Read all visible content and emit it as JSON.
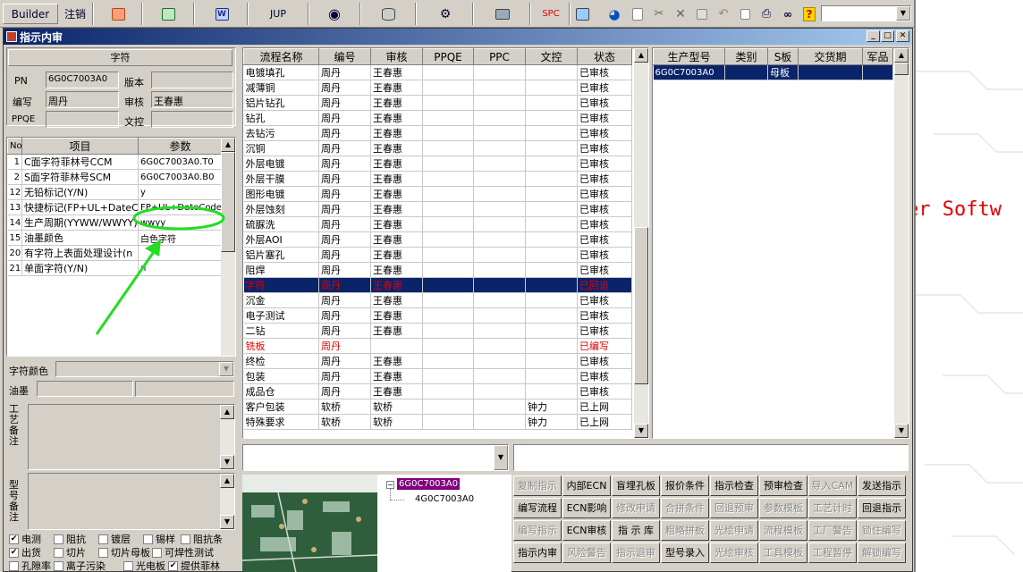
{
  "toolbar": {
    "builder": "Builder",
    "logout": "注销",
    "jup": "JUP",
    "spc": "SPC"
  },
  "window": {
    "title": "指示内审"
  },
  "char_panel": {
    "section": "字符",
    "pn_label": "PN",
    "pn_value": "6G0C7003A0",
    "version_label": "版本",
    "version_value": "",
    "author_label": "编写",
    "author_value": "周丹",
    "reviewer_label": "审核",
    "reviewer_value": "王春惠",
    "ppqe_label": "PPQE",
    "ppqe_value": "",
    "doc_label": "文控",
    "doc_value": ""
  },
  "param_table": {
    "headers": [
      "No",
      "项目",
      "参数"
    ],
    "rows": [
      {
        "no": "1",
        "item": "C面字符菲林号CCM",
        "value": "6G0C7003A0.T0"
      },
      {
        "no": "2",
        "item": "S面字符菲林号SCM",
        "value": "6G0C7003A0.B0"
      },
      {
        "no": "12",
        "item": "无铅标记(Y/N)",
        "value": "y"
      },
      {
        "no": "13",
        "item": "快捷标记(FP+UL+DateCo",
        "value": "FP+UL+DateCode"
      },
      {
        "no": "14",
        "item": "生产周期(YYWW/WWYY)",
        "value": "wwyy"
      },
      {
        "no": "15",
        "item": "油墨颜色",
        "value": "白色字符"
      },
      {
        "no": "20",
        "item": "有字符上表面处理设计(n",
        "value": ""
      },
      {
        "no": "21",
        "item": "单面字符(Y/N)",
        "value": "n"
      }
    ]
  },
  "char_color_label": "字符颜色",
  "ink_label": "油墨",
  "process_note_label": "工艺备注",
  "model_note_label": "型号备注",
  "checkboxes": [
    {
      "label": "电测",
      "checked": true
    },
    {
      "label": "阻抗",
      "checked": false
    },
    {
      "label": "镀层",
      "checked": false
    },
    {
      "label": "锡样",
      "checked": false
    },
    {
      "label": "阻抗条",
      "checked": false
    },
    {
      "label": "出货",
      "checked": true
    },
    {
      "label": "切片",
      "checked": false
    },
    {
      "label": "切片母板",
      "checked": false
    },
    {
      "label": "可焊性测试",
      "checked": false
    },
    {
      "label": "孔隙率",
      "checked": false
    },
    {
      "label": "离子污染",
      "checked": false
    },
    {
      "label": "光电板",
      "checked": false
    },
    {
      "label": "提供菲林",
      "checked": true
    }
  ],
  "process_table": {
    "headers": [
      "流程名称",
      "编号",
      "审核",
      "PPQE",
      "PPC",
      "文控",
      "状态"
    ],
    "rows": [
      {
        "name": "电镀填孔",
        "code": "周丹",
        "review": "王春惠",
        "ppqe": "",
        "ppc": "",
        "doc": "",
        "status": "已审核",
        "style": ""
      },
      {
        "name": "减薄铜",
        "code": "周丹",
        "review": "王春惠",
        "ppqe": "",
        "ppc": "",
        "doc": "",
        "status": "已审核",
        "style": ""
      },
      {
        "name": "铝片钻孔",
        "code": "周丹",
        "review": "王春惠",
        "ppqe": "",
        "ppc": "",
        "doc": "",
        "status": "已审核",
        "style": ""
      },
      {
        "name": "钻孔",
        "code": "周丹",
        "review": "王春惠",
        "ppqe": "",
        "ppc": "",
        "doc": "",
        "status": "已审核",
        "style": ""
      },
      {
        "name": "去钻污",
        "code": "周丹",
        "review": "王春惠",
        "ppqe": "",
        "ppc": "",
        "doc": "",
        "status": "已审核",
        "style": ""
      },
      {
        "name": "沉铜",
        "code": "周丹",
        "review": "王春惠",
        "ppqe": "",
        "ppc": "",
        "doc": "",
        "status": "已审核",
        "style": ""
      },
      {
        "name": "外层电镀",
        "code": "周丹",
        "review": "王春惠",
        "ppqe": "",
        "ppc": "",
        "doc": "",
        "status": "已审核",
        "style": ""
      },
      {
        "name": "外层干膜",
        "code": "周丹",
        "review": "王春惠",
        "ppqe": "",
        "ppc": "",
        "doc": "",
        "status": "已审核",
        "style": ""
      },
      {
        "name": "图形电镀",
        "code": "周丹",
        "review": "王春惠",
        "ppqe": "",
        "ppc": "",
        "doc": "",
        "status": "已审核",
        "style": ""
      },
      {
        "name": "外层蚀刻",
        "code": "周丹",
        "review": "王春惠",
        "ppqe": "",
        "ppc": "",
        "doc": "",
        "status": "已审核",
        "style": ""
      },
      {
        "name": "硫脲洗",
        "code": "周丹",
        "review": "王春惠",
        "ppqe": "",
        "ppc": "",
        "doc": "",
        "status": "已审核",
        "style": ""
      },
      {
        "name": "外层AOI",
        "code": "周丹",
        "review": "王春惠",
        "ppqe": "",
        "ppc": "",
        "doc": "",
        "status": "已审核",
        "style": ""
      },
      {
        "name": "铝片塞孔",
        "code": "周丹",
        "review": "王春惠",
        "ppqe": "",
        "ppc": "",
        "doc": "",
        "status": "已审核",
        "style": ""
      },
      {
        "name": "阻焊",
        "code": "周丹",
        "review": "王春惠",
        "ppqe": "",
        "ppc": "",
        "doc": "",
        "status": "已审核",
        "style": ""
      },
      {
        "name": "字符",
        "code": "周丹",
        "review": "王春惠",
        "ppqe": "",
        "ppc": "",
        "doc": "",
        "status": "已回退",
        "style": "hl"
      },
      {
        "name": "沉金",
        "code": "周丹",
        "review": "王春惠",
        "ppqe": "",
        "ppc": "",
        "doc": "",
        "status": "已审核",
        "style": ""
      },
      {
        "name": "电子测试",
        "code": "周丹",
        "review": "王春惠",
        "ppqe": "",
        "ppc": "",
        "doc": "",
        "status": "已审核",
        "style": ""
      },
      {
        "name": "二钻",
        "code": "周丹",
        "review": "王春惠",
        "ppqe": "",
        "ppc": "",
        "doc": "",
        "status": "已审核",
        "style": ""
      },
      {
        "name": "铣板",
        "code": "周丹",
        "review": "",
        "ppqe": "",
        "ppc": "",
        "doc": "",
        "status": "已编写",
        "style": "red"
      },
      {
        "name": "终检",
        "code": "周丹",
        "review": "王春惠",
        "ppqe": "",
        "ppc": "",
        "doc": "",
        "status": "已审核",
        "style": ""
      },
      {
        "name": "包装",
        "code": "周丹",
        "review": "王春惠",
        "ppqe": "",
        "ppc": "",
        "doc": "",
        "status": "已审核",
        "style": ""
      },
      {
        "name": "成品仓",
        "code": "周丹",
        "review": "王春惠",
        "ppqe": "",
        "ppc": "",
        "doc": "",
        "status": "已审核",
        "style": ""
      },
      {
        "name": "客户包装",
        "code": "软桥",
        "review": "软桥",
        "ppqe": "",
        "ppc": "",
        "doc": "钟力",
        "status": "已上网",
        "style": ""
      },
      {
        "name": "特殊要求",
        "code": "软桥",
        "review": "软桥",
        "ppqe": "",
        "ppc": "",
        "doc": "钟力",
        "status": "已上网",
        "style": ""
      }
    ]
  },
  "model_table": {
    "headers": [
      "生产型号",
      "类别",
      "S板",
      "交货期",
      "军品"
    ],
    "rows": [
      {
        "model": "6G0C7003A0",
        "type": "",
        "sboard": "母板",
        "due": "",
        "mil": ""
      }
    ]
  },
  "tree": {
    "root": "6G0C7003A0",
    "child": "4G0C7003A0"
  },
  "buttons": [
    {
      "label": "复制指示",
      "enabled": false
    },
    {
      "label": "内部ECN",
      "enabled": true
    },
    {
      "label": "盲埋孔板",
      "enabled": true
    },
    {
      "label": "报价条件",
      "enabled": true
    },
    {
      "label": "指示检查",
      "enabled": true
    },
    {
      "label": "预审检查",
      "enabled": true
    },
    {
      "label": "导入CAM",
      "enabled": false
    },
    {
      "label": "发送指示",
      "enabled": true
    },
    {
      "label": "编写流程",
      "enabled": true
    },
    {
      "label": "ECN影响",
      "enabled": true
    },
    {
      "label": "修改申请",
      "enabled": false
    },
    {
      "label": "合拼条件",
      "enabled": false
    },
    {
      "label": "回退预审",
      "enabled": false
    },
    {
      "label": "参数模板",
      "enabled": false
    },
    {
      "label": "工艺计时",
      "enabled": false
    },
    {
      "label": "回退指示",
      "enabled": true
    },
    {
      "label": "编写指示",
      "enabled": false
    },
    {
      "label": "ECN审核",
      "enabled": true
    },
    {
      "label": "指 示 库",
      "enabled": true
    },
    {
      "label": "粗略拼板",
      "enabled": false
    },
    {
      "label": "光绘申请",
      "enabled": false
    },
    {
      "label": "流程模板",
      "enabled": false
    },
    {
      "label": "工厂警告",
      "enabled": false
    },
    {
      "label": "锁住编写",
      "enabled": false
    },
    {
      "label": "指示内审",
      "enabled": true
    },
    {
      "label": "风险警告",
      "enabled": false
    },
    {
      "label": "指示退审",
      "enabled": false
    },
    {
      "label": "型号录入",
      "enabled": true
    },
    {
      "label": "光绘审核",
      "enabled": false
    },
    {
      "label": "工具模板",
      "enabled": false
    },
    {
      "label": "工程暂停",
      "enabled": false
    },
    {
      "label": "解锁编写",
      "enabled": false
    }
  ],
  "background_text": "er Softw",
  "colors": {
    "titlebar": "#0a246a",
    "selection": "#0a246a",
    "alert": "#e00000",
    "annotation": "#22dd22"
  }
}
